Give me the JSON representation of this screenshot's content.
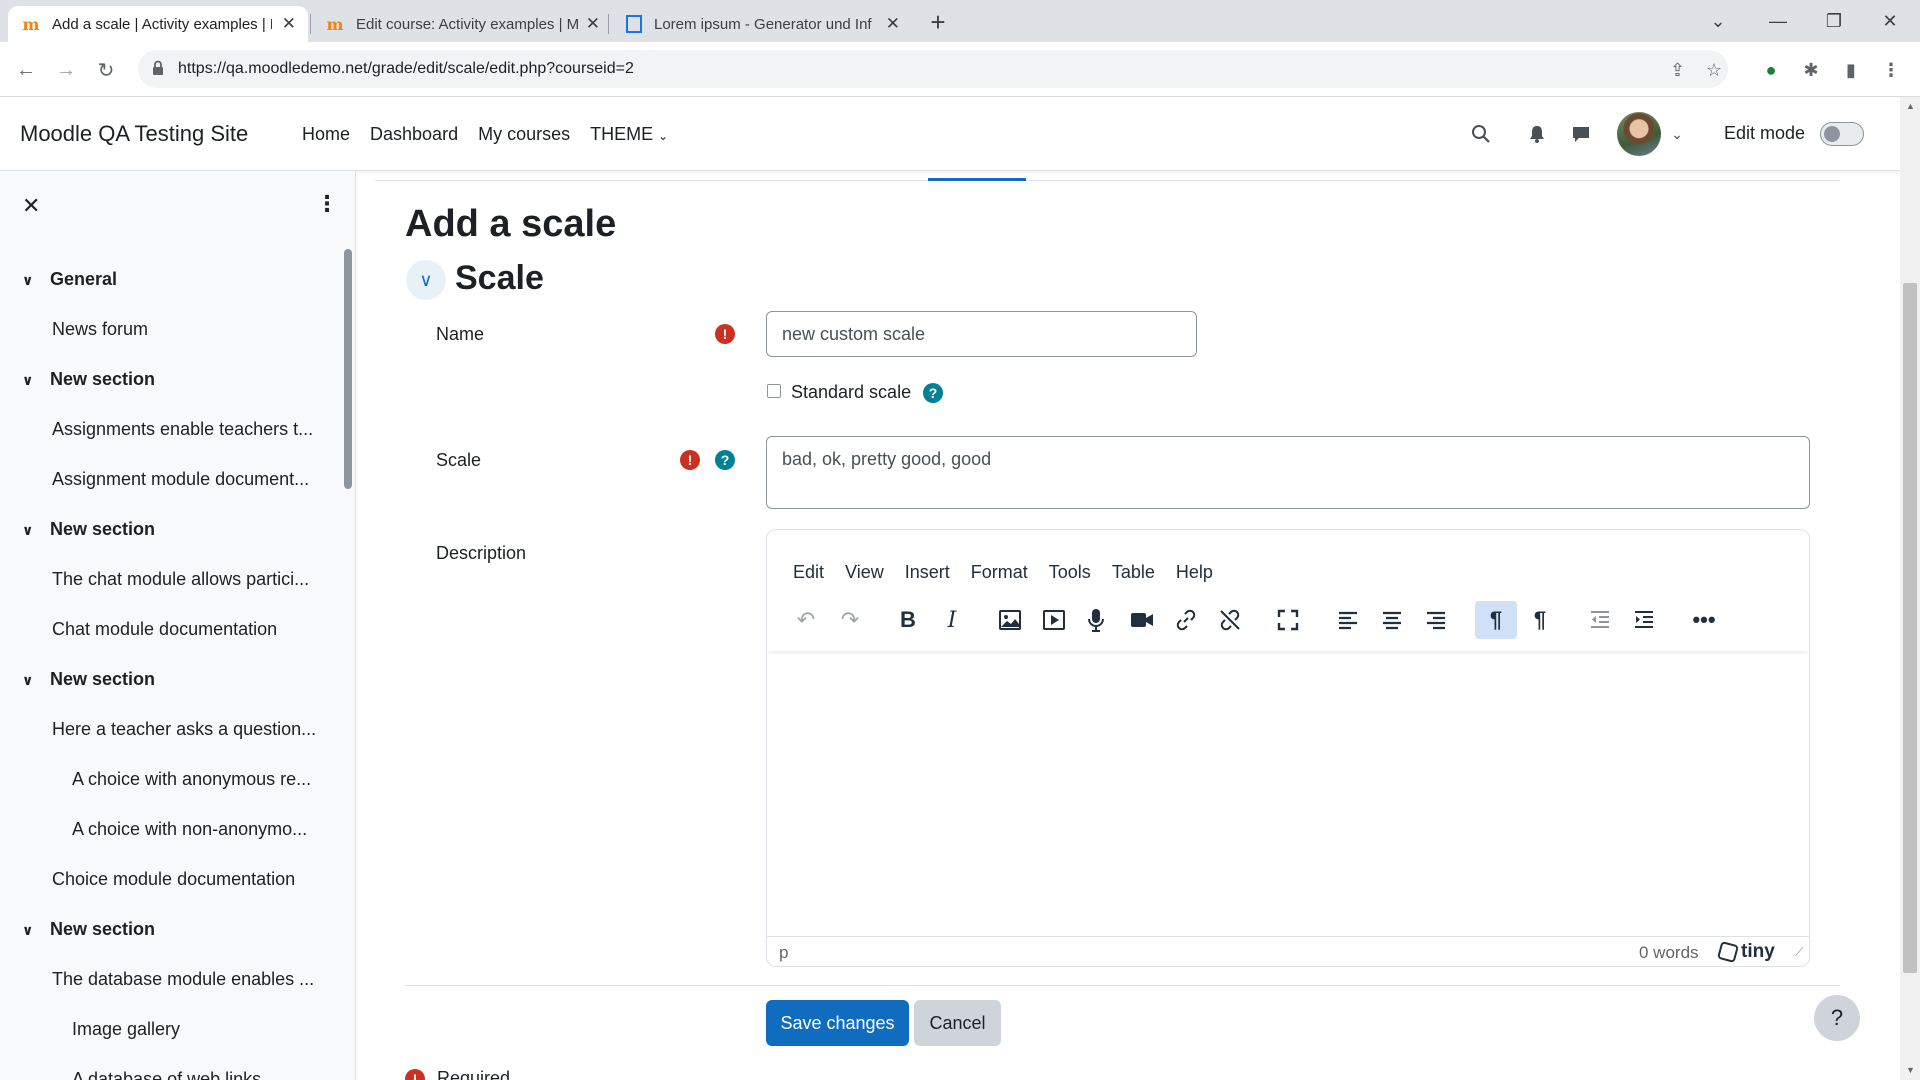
{
  "browser": {
    "tabs": [
      {
        "title": "Add a scale | Activity examples | M",
        "favicon": "moodle-favicon",
        "active": true
      },
      {
        "title": "Edit course: Activity examples | M",
        "favicon": "moodle-favicon",
        "active": false
      },
      {
        "title": "Lorem ipsum - Generator und Inf",
        "favicon": "lorem-favicon",
        "active": false
      }
    ],
    "url": "https://qa.moodledemo.net/grade/edit/scale/edit.php?courseid=2",
    "new_tab_label": "+",
    "tab_close": "✕"
  },
  "navbar": {
    "site_name": "Moodle QA Testing Site",
    "items": [
      "Home",
      "Dashboard",
      "My courses",
      "THEME"
    ],
    "edit_mode_label": "Edit mode"
  },
  "drawer": {
    "items": [
      {
        "label": "General",
        "type": "section"
      },
      {
        "label": "News forum",
        "type": "activity"
      },
      {
        "label": "New section",
        "type": "section"
      },
      {
        "label": "Assignments enable teachers t...",
        "type": "activity"
      },
      {
        "label": "Assignment module document...",
        "type": "activity"
      },
      {
        "label": "New section",
        "type": "section"
      },
      {
        "label": "The chat module allows partici...",
        "type": "activity"
      },
      {
        "label": "Chat module documentation",
        "type": "activity"
      },
      {
        "label": "New section",
        "type": "section"
      },
      {
        "label": "Here a teacher asks a question...",
        "type": "activity"
      },
      {
        "label": "A choice with anonymous re...",
        "type": "sub"
      },
      {
        "label": "A choice with non-anonymo...",
        "type": "sub"
      },
      {
        "label": "Choice module documentation",
        "type": "activity"
      },
      {
        "label": "New section",
        "type": "section"
      },
      {
        "label": "The database module enables ...",
        "type": "activity"
      },
      {
        "label": "Image gallery",
        "type": "sub"
      },
      {
        "label": "A database of web links",
        "type": "sub"
      }
    ]
  },
  "main": {
    "page_title": "Add a scale",
    "section_title": "Scale",
    "name_label": "Name",
    "name_value": "new custom scale",
    "standard_scale_label": "Standard scale",
    "scale_label": "Scale",
    "scale_value": "bad, ok, pretty good, good",
    "description_label": "Description",
    "editor": {
      "menu": [
        "Edit",
        "View",
        "Insert",
        "Format",
        "Tools",
        "Table",
        "Help"
      ],
      "status_path": "p",
      "word_count": "0 words",
      "brand": "tiny"
    },
    "save_label": "Save changes",
    "cancel_label": "Cancel",
    "required_label": "Required",
    "help_label": "?"
  },
  "colors": {
    "primary": "#0f6cbf",
    "required": "#ca3120",
    "help": "#008196"
  }
}
